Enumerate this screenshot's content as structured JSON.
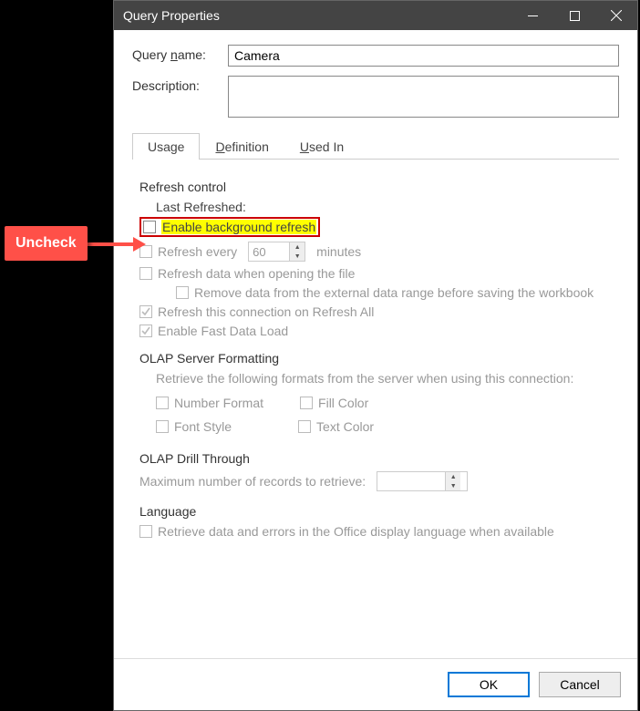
{
  "callout": {
    "text": "Uncheck"
  },
  "titlebar": {
    "title": "Query Properties"
  },
  "form": {
    "name_label": "Query name:",
    "name_value": "Camera",
    "desc_label": "Description:",
    "desc_value": ""
  },
  "tabs": {
    "usage": "Usage",
    "definition": "Definition",
    "usedin": "Used In"
  },
  "refresh": {
    "heading": "Refresh control",
    "last": "Last Refreshed:",
    "enable_bg": "Enable background refresh",
    "refresh_every_pre": "Refresh every",
    "refresh_every_val": "60",
    "refresh_every_post": "minutes",
    "on_open": "Refresh data when opening the file",
    "remove_before_save": "Remove data from the external data range before saving the workbook",
    "refresh_all": "Refresh this connection on Refresh All",
    "fast_load": "Enable Fast Data Load"
  },
  "olap": {
    "heading": "OLAP Server Formatting",
    "retrieve_text": "Retrieve the following formats from the server when using this connection:",
    "number_format": "Number Format",
    "fill_color": "Fill Color",
    "font_style": "Font Style",
    "text_color": "Text Color"
  },
  "drill": {
    "heading": "OLAP Drill Through",
    "max_label": "Maximum number of records to retrieve:",
    "max_value": ""
  },
  "language": {
    "heading": "Language",
    "retrieve": "Retrieve data and errors in the Office display language when available"
  },
  "buttons": {
    "ok": "OK",
    "cancel": "Cancel"
  }
}
